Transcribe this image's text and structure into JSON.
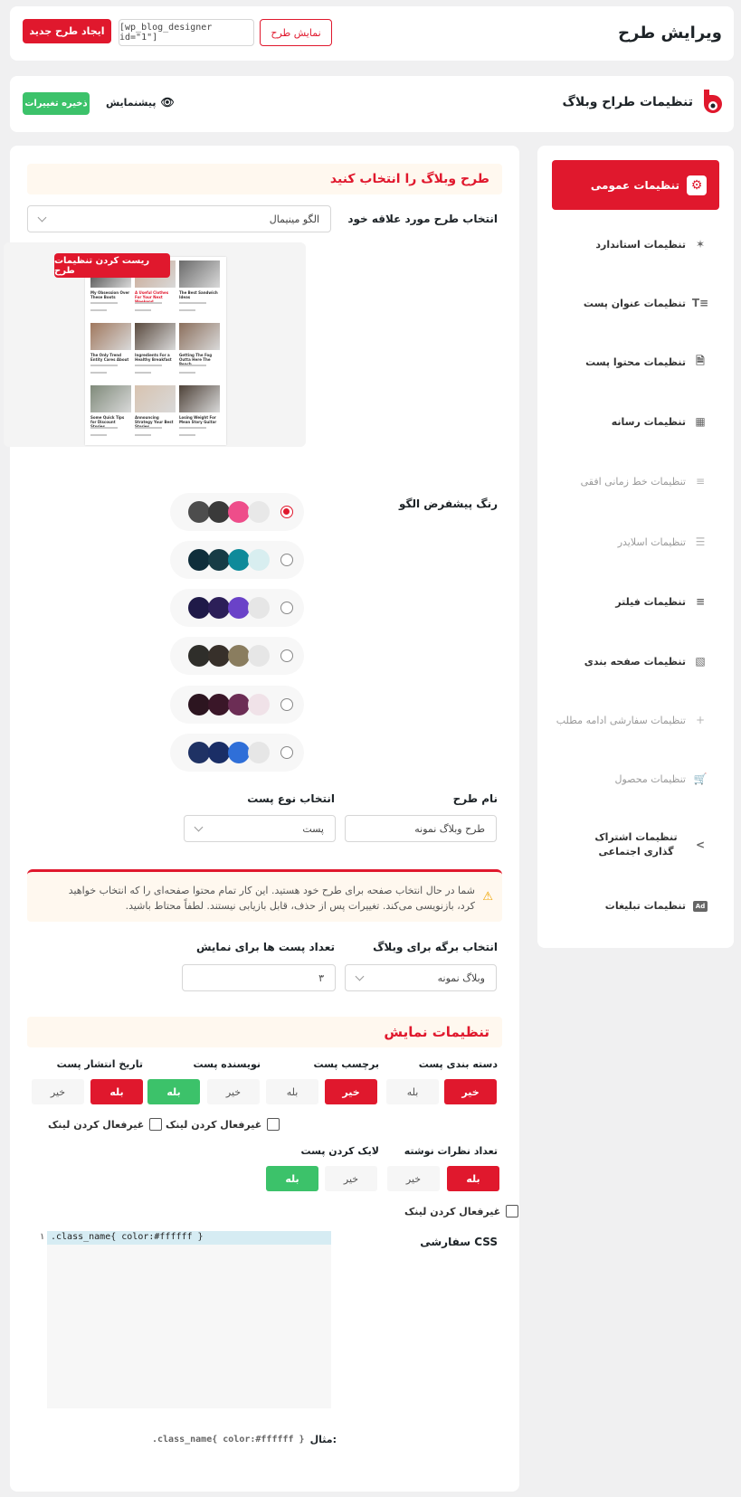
{
  "header": {
    "title": "ویرایش طرح",
    "new_design_label": "ایجاد طرح جدید",
    "shortcode_value": "[wp_blog_designer id=\"1\"]",
    "view_design_label": "نمایش طرح"
  },
  "subheader": {
    "title": "تنظیمات طراح وبلاگ",
    "preview_label": "پیشنمایش",
    "save_label": "ذخیره تغییرات"
  },
  "sidebar": {
    "items": [
      {
        "label": "تنظیمات عمومی",
        "icon": "gear-icon"
      },
      {
        "label": "تنظیمات استاندارد",
        "icon": "star-settings-icon"
      },
      {
        "label": "تنظیمات عنوان پست",
        "icon": "title-icon"
      },
      {
        "label": "تنظیمات محتوا پست",
        "icon": "document-add-icon"
      },
      {
        "label": "تنظیمات رسانه",
        "icon": "image-icon"
      },
      {
        "label": "تنظیمات خط زمانی افقی",
        "icon": "timeline-icon"
      },
      {
        "label": "تنظیمات اسلایدر",
        "icon": "sliders-icon"
      },
      {
        "label": "تنظیمات فیلتر",
        "icon": "filter-icon"
      },
      {
        "label": "تنظیمات صفحه بندی",
        "icon": "book-icon"
      },
      {
        "label": "تنظیمات سفارشی ادامه مطلب",
        "icon": "plus-icon"
      },
      {
        "label": "تنظیمات محصول",
        "icon": "cart-icon"
      },
      {
        "label": "تنظیمات اشتراک گذاری اجتماعی",
        "icon": "share-icon"
      },
      {
        "label": "تنظیمات تبلیغات",
        "icon": "ad-icon"
      }
    ]
  },
  "main": {
    "choose_banner": "طرح وبلاگ را انتخاب کنید",
    "template_label": "انتخاب طرح مورد علاقه خود",
    "template_value": "الگو مینیمال",
    "reset_label": "ریست کردن تنظیمات طرح",
    "color_label": "رنگ پیشفرض الگو",
    "palettes": [
      {
        "colors": [
          "#e8e8e8",
          "#ee4d8a",
          "#3a3a3a",
          "#4d4d4d"
        ],
        "selected": true
      },
      {
        "colors": [
          "#d8eef0",
          "#0e8a9a",
          "#173c46",
          "#0f2e3b"
        ],
        "selected": false
      },
      {
        "colors": [
          "#e6e6e6",
          "#6a42c8",
          "#2c1f58",
          "#1f1a48"
        ],
        "selected": false
      },
      {
        "colors": [
          "#e6e6e6",
          "#8a7d5f",
          "#37302a",
          "#2f2e2a"
        ],
        "selected": false
      },
      {
        "colors": [
          "#f0e2e8",
          "#6c2d55",
          "#3a1628",
          "#2c1520"
        ],
        "selected": false
      },
      {
        "colors": [
          "#e6e6e6",
          "#2f6fd8",
          "#1a2e66",
          "#1f3264"
        ],
        "selected": false
      }
    ],
    "design_name_label": "نام طرح",
    "design_name_value": "طرح وبلاگ نمونه",
    "post_type_label": "انتخاب نوع پست",
    "post_type_value": "پست",
    "warning_text": "شما در حال انتخاب صفحه برای طرح خود هستید. این کار تمام محتوا صفحه‌ای را که انتخاب خواهید کرد، بازنویسی می‌کند. تغییرات پس از حذف، قابل بازیابی نیستند. لطفاً محتاط باشید.",
    "blog_page_label": "انتخاب برگه برای وبلاگ",
    "blog_page_value": "وبلاگ نمونه",
    "posts_count_label": "تعداد پست ها برای نمایش",
    "posts_count_value": "۳",
    "display_banner": "تنظیمات نمایش",
    "toggles": {
      "category_label": "دسته بندی پست",
      "tag_label": "برچسب پست",
      "author_label": "نویسنده پست",
      "date_label": "تاریخ انتشار پست",
      "comments_label": "تعداد نظرات نوشته",
      "like_label": "لایک کردن پست",
      "yes": "بله",
      "no": "خیر",
      "disable_link": "غیرفعال کردن لینک"
    },
    "css_label": "CSS سفارشی",
    "css_code": ".class_name{ color:#ffffff }",
    "css_line_number": "۱",
    "example_label": "مثال:",
    "example_code": ".class_name{ color:#ffffff }"
  },
  "preview_cards": [
    {
      "title": "The Best Sandwich Ideas",
      "highlight": false
    },
    {
      "title": "A Useful Clothes For Your Next Weekend",
      "highlight": true
    },
    {
      "title": "My Obsession Over These Boots",
      "highlight": false
    },
    {
      "title": "Getting The Fog Outta Here The Beach",
      "highlight": false
    },
    {
      "title": "Ingredients For a Healthy Breakfast",
      "highlight": false
    },
    {
      "title": "The Only Trend Entity Cares About",
      "highlight": false
    },
    {
      "title": "Losing Weight For Mean Story Guitar",
      "highlight": false
    },
    {
      "title": "Announcing Strategy Your Best Stories",
      "highlight": false
    },
    {
      "title": "Some Quick Tips for Discount Stories",
      "highlight": false
    }
  ]
}
